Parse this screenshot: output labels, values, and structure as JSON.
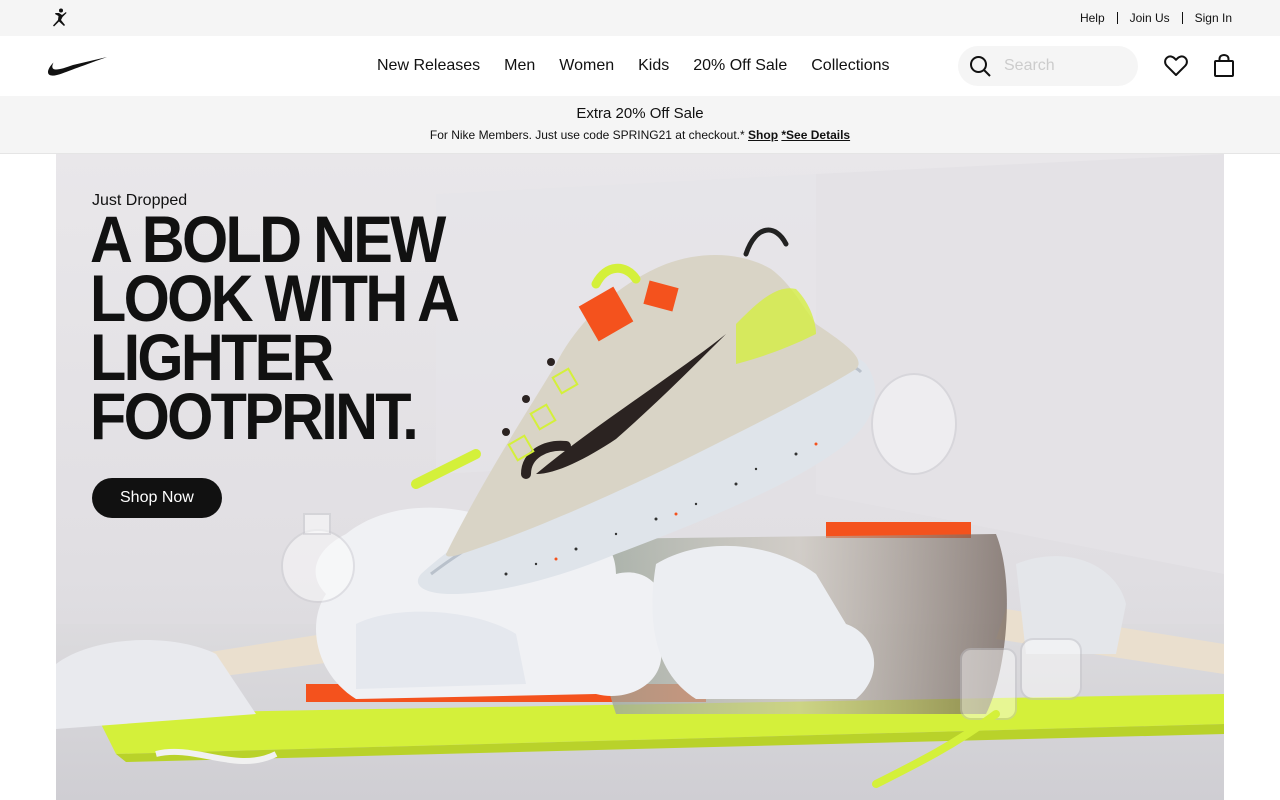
{
  "utility": {
    "logo_icon": "jordan-jumpman-icon",
    "links": [
      "Help",
      "Join Us",
      "Sign In"
    ]
  },
  "nav": {
    "logo_icon": "nike-swoosh-icon",
    "items": [
      {
        "label": "New Releases"
      },
      {
        "label": "Men"
      },
      {
        "label": "Women"
      },
      {
        "label": "Kids"
      },
      {
        "label": "20% Off Sale"
      },
      {
        "label": "Collections"
      }
    ],
    "search": {
      "placeholder": "Search",
      "icon": "search-icon"
    },
    "favorites_icon": "heart-icon",
    "bag_icon": "shopping-bag-icon"
  },
  "promo": {
    "title": "Extra 20% Off Sale",
    "text": "For Nike Members. Just use code SPRING21 at checkout.*",
    "shop_link": "Shop",
    "details_link": "*See Details"
  },
  "hero": {
    "subtitle": "Just Dropped",
    "headline": "A BOLD NEW\nLOOK WITH A\nLIGHTER\nFOOTPRINT.",
    "cta": "Shop Now"
  },
  "colors": {
    "text": "#111111",
    "utility_bg": "#f5f5f5",
    "accent_volt": "#d4f03a",
    "accent_orange": "#f4521d"
  }
}
